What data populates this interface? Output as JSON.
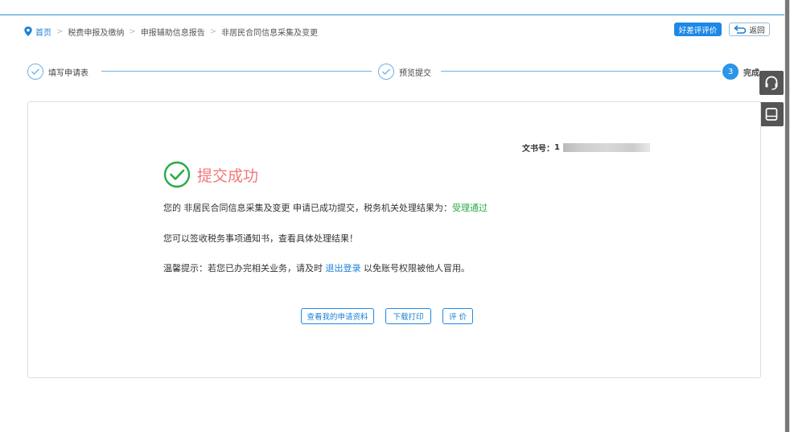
{
  "breadcrumb": {
    "home": "首页",
    "items": [
      "税费申报及缴纳",
      "申报辅助信息报告",
      "非居民合同信息采集及变更"
    ],
    "separator": ">"
  },
  "header": {
    "evaluate_label": "好差评评价",
    "back_label": "返回"
  },
  "steps": [
    {
      "label": "填写申请表",
      "marker": ""
    },
    {
      "label": "预览提交",
      "marker": ""
    },
    {
      "label": "完成",
      "marker": "3"
    }
  ],
  "document": {
    "number_label": "文书号：",
    "number_value": "1"
  },
  "result": {
    "title": "提交成功",
    "line1_prefix": "您的 非居民合同信息采集及变更 申请已成功提交，税务机关处理结果为：",
    "line1_status": "受理通过",
    "line2": "您可以签收税务事项通知书，查看具体处理结果！",
    "line3_prefix": "温馨提示：若您已办完相关业务，请及时 ",
    "line3_link": "退出登录",
    "line3_suffix": " 以免账号权限被他人冒用。"
  },
  "actions": {
    "view_label": "查看我的申请资料",
    "download_label": "下载打印",
    "rate_label": "评 价"
  },
  "colors": {
    "accent": "#1e88e5",
    "success_text": "#f07878",
    "success_icon": "#2aaa47",
    "pass_status": "#2aaa47"
  },
  "icons": {
    "breadcrumb": "location-pin-icon",
    "back": "return-arrow-icon",
    "step_done": "check-icon",
    "success": "check-circle-icon",
    "side_tool_1": "headset-icon",
    "side_tool_2": "notebook-icon"
  }
}
